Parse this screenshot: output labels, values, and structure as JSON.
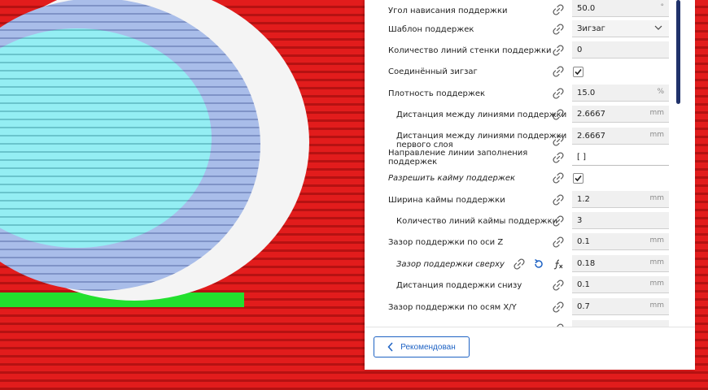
{
  "settings": {
    "rows": [
      {
        "label": "Угол нависания поддержки",
        "value": "50.0",
        "unit": "°"
      },
      {
        "label": "Шаблон поддержек",
        "value": "Зигзаг"
      },
      {
        "label": "Количество линий стенки поддержки",
        "value": "0"
      },
      {
        "label": "Соединённый зигзаг"
      },
      {
        "label": "Плотность поддержек",
        "value": "15.0",
        "unit": "%"
      },
      {
        "label": "Дистанция между линиями поддержки",
        "value": "2.6667",
        "unit": "mm"
      },
      {
        "label": "Дистанция между линиями поддержки первого слоя",
        "value": "2.6667",
        "unit": "mm"
      },
      {
        "label": "Направление линии заполнения поддержек",
        "value": "[ ]"
      },
      {
        "label": "Разрешить кайму поддержек"
      },
      {
        "label": "Ширина каймы поддержки",
        "value": "1.2",
        "unit": "mm"
      },
      {
        "label": "Количество линий каймы поддержки",
        "value": "3"
      },
      {
        "label": "Зазор поддержки по оси Z",
        "value": "0.1",
        "unit": "mm"
      },
      {
        "label": "Зазор поддержки сверху",
        "value": "0.18",
        "unit": "mm"
      },
      {
        "label": "Дистанция поддержки снизу",
        "value": "0.1",
        "unit": "mm"
      },
      {
        "label": "Зазор поддержки по осям X/Y",
        "value": "0.7",
        "unit": "mm"
      }
    ]
  },
  "footer": {
    "recommended_label": "Рекомендован"
  },
  "colors": {
    "accent": "#1f63c4",
    "scrollbar": "#20326b",
    "model_red": "#d82020",
    "support_cyan": "#8ee6ec",
    "support_blue": "#9fb4e6",
    "skirt_green": "#22e02e"
  },
  "icons": {
    "link": "link-icon",
    "reset": "reset-icon",
    "formula": "fx-icon",
    "chevron": "chevron-down-icon",
    "back": "chevron-left-icon",
    "check": "checkmark-icon"
  }
}
